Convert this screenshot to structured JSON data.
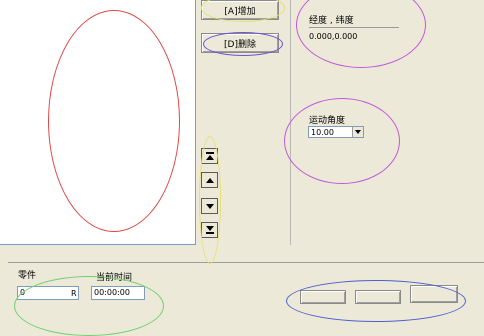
{
  "buttons": {
    "add_label": "[A]增加",
    "delete_label": "[D]删除"
  },
  "coordinates": {
    "header": "经度 , 纬度",
    "value": "0.000,0.000"
  },
  "motion_angle": {
    "label": "运动角度",
    "selected": "10.00"
  },
  "bottom": {
    "part_label": "零件",
    "part_value": "0",
    "part_unit": "R",
    "time_label": "当前时间",
    "time_value": "00:00:00"
  },
  "annotation_colors": {
    "red": "#e04848",
    "purple": "#c058d8",
    "blue": "#4d5fd0",
    "yellow": "#e8e070",
    "green": "#70d070"
  }
}
